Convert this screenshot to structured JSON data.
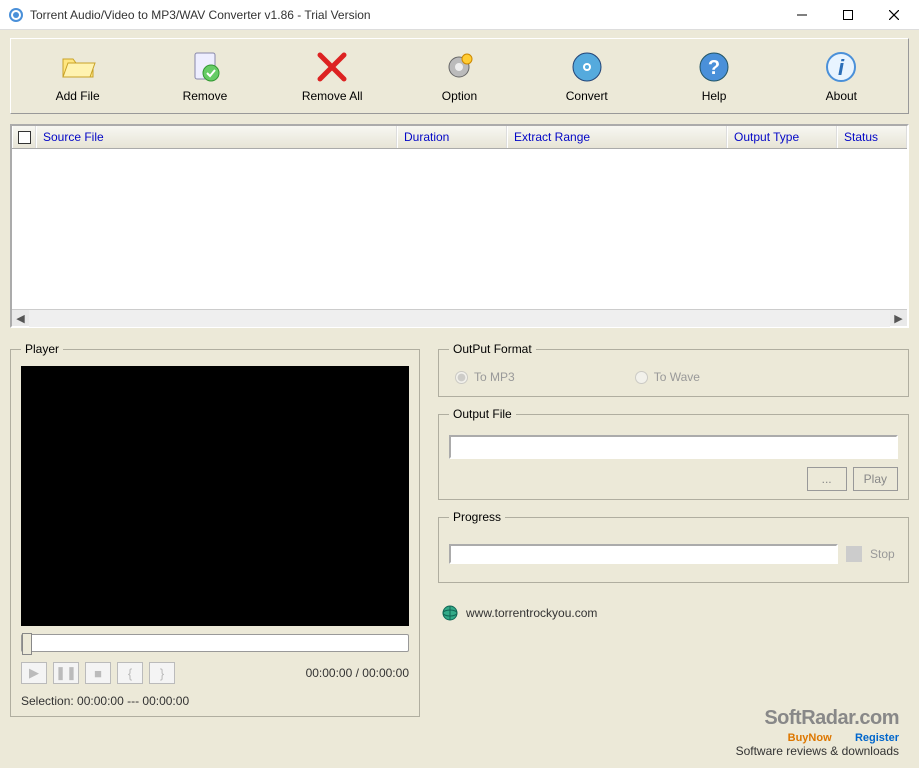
{
  "window": {
    "title": "Torrent Audio/Video to MP3/WAV Converter v1.86 - Trial Version"
  },
  "toolbar": {
    "addFile": "Add File",
    "remove": "Remove",
    "removeAll": "Remove All",
    "option": "Option",
    "convert": "Convert",
    "help": "Help",
    "about": "About"
  },
  "columns": {
    "sourceFile": "Source File",
    "duration": "Duration",
    "extractRange": "Extract Range",
    "outputType": "Output Type",
    "status": "Status"
  },
  "player": {
    "legend": "Player",
    "time": "00:00:00 / 00:00:00",
    "selection": "Selection: 00:00:00 --- 00:00:00",
    "braceOpen": "{",
    "braceClose": "}"
  },
  "outputFormat": {
    "legend": "OutPut Format",
    "toMp3": "To MP3",
    "toWave": "To Wave"
  },
  "outputFile": {
    "legend": "Output File",
    "value": "",
    "browse": "...",
    "play": "Play"
  },
  "progress": {
    "legend": "Progress",
    "stop": "Stop"
  },
  "footer": {
    "url": "www.torrentrockyou.com"
  },
  "watermark": {
    "brand": "SoftRadar.com",
    "tagline": "Software reviews & downloads",
    "buyNow": "BuyNow",
    "register": "Register"
  }
}
